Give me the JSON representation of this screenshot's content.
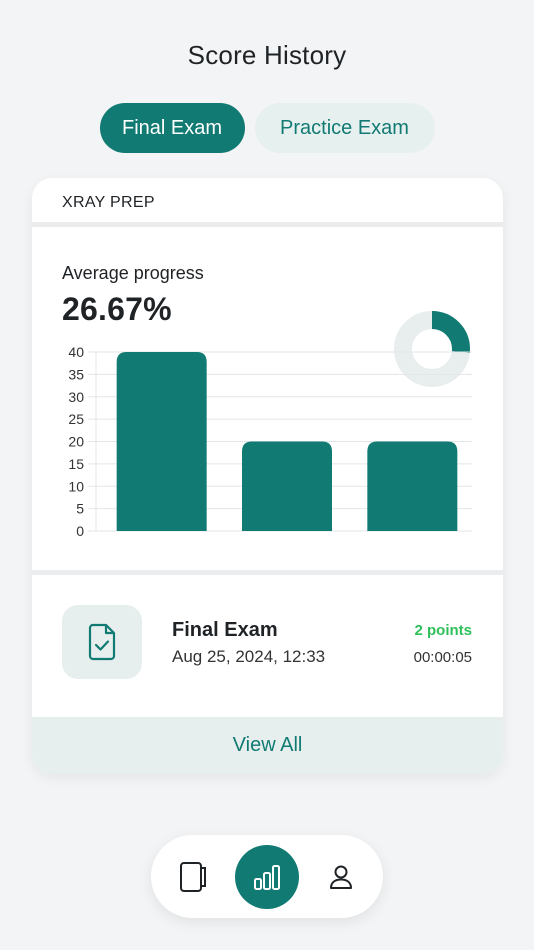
{
  "header": {
    "title": "Score History"
  },
  "tabs": [
    {
      "label": "Final Exam",
      "active": true
    },
    {
      "label": "Practice Exam",
      "active": false
    }
  ],
  "card": {
    "section_title": "XRAY PREP",
    "average": {
      "label": "Average progress",
      "value": "26.67%",
      "fraction": 0.2667
    },
    "latest_exam": {
      "name": "Final Exam",
      "date": "Aug 25, 2024, 12:33",
      "points": "2 points",
      "duration": "00:00:05",
      "icon": "document-check-icon"
    },
    "view_all_label": "View All"
  },
  "chart_data": {
    "type": "bar",
    "categories": [
      "",
      "",
      ""
    ],
    "values": [
      40,
      20,
      20
    ],
    "ylim": [
      0,
      40
    ],
    "yticks": [
      0,
      5,
      10,
      15,
      20,
      25,
      30,
      35,
      40
    ],
    "grid": true,
    "bar_color": "#117a73"
  },
  "bottom_nav": [
    {
      "icon": "notebook-icon",
      "active": false
    },
    {
      "icon": "bar-chart-icon",
      "active": true
    },
    {
      "icon": "user-icon",
      "active": false
    }
  ],
  "colors": {
    "accent": "#117a73",
    "accent_light": "#e6f0ef",
    "success": "#2fc05a",
    "background": "#f2f4f5"
  }
}
